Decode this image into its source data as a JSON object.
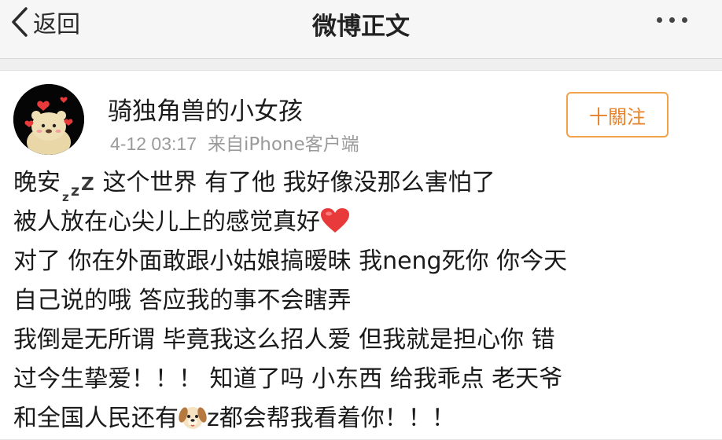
{
  "nav": {
    "back_label": "返回",
    "title": "微博正文"
  },
  "post": {
    "author": "骑独角兽的小女孩",
    "time": "4-12 03:17",
    "source": "来自iPhone客户端",
    "follow_label": "十關注",
    "lines": {
      "l1_a": "晚安",
      "l1_b": " 这个世界 有了他 我好像没那么害怕了",
      "l2": "被人放在心尖儿上的感觉真好",
      "l3": "对了 你在外面敢跟小姑娘搞暧昧 我neng死你 你今天",
      "l4": "自己说的哦 答应我的事不会瞎弄",
      "l5": "我倒是无所谓 毕竟我这么招人爱  但我就是担心你 错",
      "l6": "过今生挚爱！！！ 知道了吗 小东西 给我乖点 老天爷",
      "l7_a": "和全国人民还有",
      "l7_b": "z都会帮我看着你！！！"
    }
  },
  "icons": {
    "back": "chevron-left-icon",
    "more": "more-dots-icon",
    "zzz": "zzz-sleep-emoji",
    "heart": "red-heart-emoji",
    "dog": "dog-face-emoji"
  },
  "colors": {
    "follow_accent": "#e8822a",
    "nav_bg": "#f6f6f6",
    "meta_text": "#9a9a9a",
    "heart": "#e83a3a"
  }
}
